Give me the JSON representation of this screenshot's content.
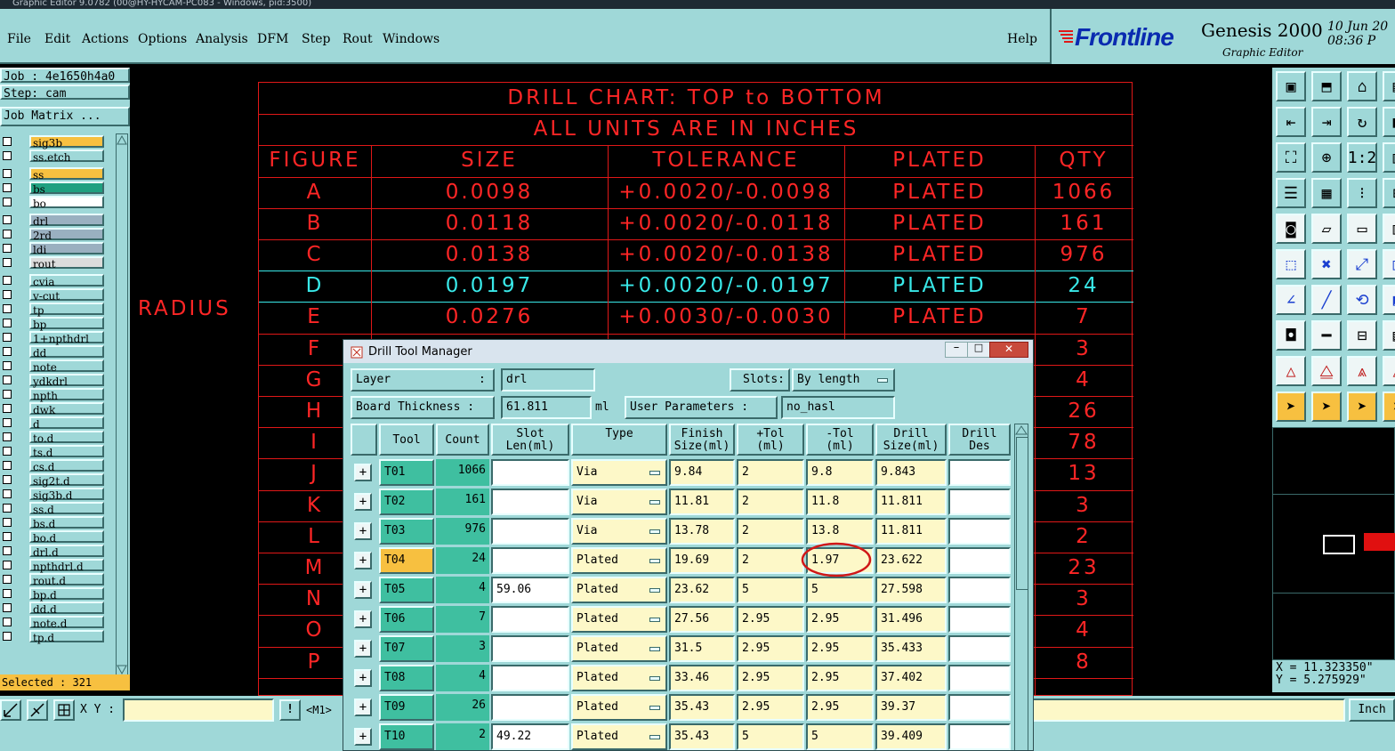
{
  "window_title": "Graphic Editor 9.0782 (00@HY-HYCAM-PC083 - Windows, pid:3500)",
  "menu": [
    "File",
    "Edit",
    "Actions",
    "Options",
    "Analysis",
    "DFM",
    "Step",
    "Rout",
    "Windows"
  ],
  "help": "Help",
  "brand": {
    "logo": "Frontline",
    "product": "Genesis 2000",
    "subtitle": "Graphic Editor",
    "date": "10 Jun 20",
    "time": "08:36 P"
  },
  "job": "Job : 4e1650h4a0",
  "step": "Step: cam",
  "job_matrix": "Job Matrix ...",
  "layers": [
    {
      "name": "sig3b",
      "color": "#f7c040"
    },
    {
      "name": "ss.etch",
      "color": "#9fd8d8"
    },
    {
      "name": "ss",
      "color": "#f7c040"
    },
    {
      "name": "bs",
      "color": "#20a080"
    },
    {
      "name": "bo",
      "color": "#ffffff"
    },
    {
      "name": "drl",
      "color": "#9ab0c0"
    },
    {
      "name": "2rd",
      "color": "#9ab0c0"
    },
    {
      "name": "ldi",
      "color": "#9ab0c0"
    },
    {
      "name": "rout",
      "color": "#dcdcdc"
    },
    {
      "name": "cvia",
      "color": "#9fd8d8"
    },
    {
      "name": "v-cut",
      "color": "#9fd8d8"
    },
    {
      "name": "tp",
      "color": "#9fd8d8"
    },
    {
      "name": "bp",
      "color": "#9fd8d8"
    },
    {
      "name": "1+npthdrl",
      "color": "#9fd8d8"
    },
    {
      "name": "dd",
      "color": "#9fd8d8"
    },
    {
      "name": "note",
      "color": "#9fd8d8"
    },
    {
      "name": "ydkdrl",
      "color": "#9fd8d8"
    },
    {
      "name": "npth",
      "color": "#9fd8d8"
    },
    {
      "name": "dwk",
      "color": "#9fd8d8"
    },
    {
      "name": "d",
      "color": "#9fd8d8"
    },
    {
      "name": "to.d",
      "color": "#9fd8d8"
    },
    {
      "name": "ts.d",
      "color": "#9fd8d8"
    },
    {
      "name": "cs.d",
      "color": "#9fd8d8"
    },
    {
      "name": "sig2t.d",
      "color": "#9fd8d8"
    },
    {
      "name": "sig3b.d",
      "color": "#9fd8d8"
    },
    {
      "name": "ss.d",
      "color": "#9fd8d8"
    },
    {
      "name": "bs.d",
      "color": "#9fd8d8"
    },
    {
      "name": "bo.d",
      "color": "#9fd8d8"
    },
    {
      "name": "drl.d",
      "color": "#9fd8d8"
    },
    {
      "name": "npthdrl.d",
      "color": "#9fd8d8"
    },
    {
      "name": "rout.d",
      "color": "#9fd8d8"
    },
    {
      "name": "bp.d",
      "color": "#9fd8d8"
    },
    {
      "name": "dd.d",
      "color": "#9fd8d8"
    },
    {
      "name": "note.d",
      "color": "#9fd8d8"
    },
    {
      "name": "tp.d",
      "color": "#9fd8d8"
    }
  ],
  "selected": "Selected : 321",
  "chart": {
    "title1": "DRILL CHART: TOP to BOTTOM",
    "title2": "ALL UNITS ARE IN INCHES",
    "headers": [
      "FIGURE",
      "SIZE",
      "TOLERANCE",
      "PLATED",
      "QTY"
    ],
    "rows": [
      {
        "fig": "A",
        "size": "0.0098",
        "tol": "+0.0020/-0.0098",
        "plated": "PLATED",
        "qty": "1066",
        "hl": false
      },
      {
        "fig": "B",
        "size": "0.0118",
        "tol": "+0.0020/-0.0118",
        "plated": "PLATED",
        "qty": "161",
        "hl": false
      },
      {
        "fig": "C",
        "size": "0.0138",
        "tol": "+0.0020/-0.0138",
        "plated": "PLATED",
        "qty": "976",
        "hl": false
      },
      {
        "fig": "D",
        "size": "0.0197",
        "tol": "+0.0020/-0.0197",
        "plated": "PLATED",
        "qty": "24",
        "hl": true
      },
      {
        "fig": "E",
        "size": "0.0276",
        "tol": "+0.0030/-0.0030",
        "plated": "PLATED",
        "qty": "7",
        "hl": false
      },
      {
        "fig": "F",
        "size": "",
        "tol": "",
        "plated": "",
        "qty": "3",
        "hl": false
      },
      {
        "fig": "G",
        "size": "",
        "tol": "",
        "plated": "",
        "qty": "4",
        "hl": false
      },
      {
        "fig": "H",
        "size": "",
        "tol": "",
        "plated": "",
        "qty": "26",
        "hl": false
      },
      {
        "fig": "I",
        "size": "",
        "tol": "",
        "plated": "",
        "qty": "78",
        "hl": false
      },
      {
        "fig": "J",
        "size": "",
        "tol": "",
        "plated": "",
        "qty": "13",
        "hl": false
      },
      {
        "fig": "K",
        "size": "",
        "tol": "",
        "plated": "",
        "qty": "3",
        "hl": false
      },
      {
        "fig": "L",
        "size": "",
        "tol": "",
        "plated": "",
        "qty": "2",
        "hl": false
      },
      {
        "fig": "M",
        "size": "",
        "tol": "",
        "plated": "",
        "qty": "23",
        "hl": false
      },
      {
        "fig": "N",
        "size": "",
        "tol": "",
        "plated": "",
        "qty": "3",
        "hl": false
      },
      {
        "fig": "O",
        "size": "",
        "tol": "",
        "plated": "",
        "qty": "4",
        "hl": false
      },
      {
        "fig": "P",
        "size": "",
        "tol": "",
        "plated": "",
        "qty": "8",
        "hl": false
      }
    ]
  },
  "radius_label": "RADIUS",
  "coords": {
    "x": "X = 11.323350\"",
    "y": "Y = 5.275929\""
  },
  "bottom": {
    "xy_label": "X Y :",
    "mode": "<M1>",
    "unit": "Inch"
  },
  "dialog": {
    "title": "Drill Tool Manager",
    "layer_label": "Layer",
    "layer_colon": ":",
    "layer_value": "drl",
    "slots_label": "Slots:",
    "slots_value": "By length",
    "board_thickness_label": "Board Thickness :",
    "board_thickness_value": "61.811",
    "board_thickness_unit": "ml",
    "user_params_label": "User Parameters :",
    "user_params_value": "no_hasl",
    "columns": [
      "Tool",
      "Count",
      "Slot\nLen(ml)",
      "Type",
      "Finish\nSize(ml)",
      "+Tol\n(ml)",
      "-Tol\n(ml)",
      "Drill\nSize(ml)",
      "Drill\nDes"
    ],
    "tools": [
      {
        "tool": "T01",
        "count": "1066",
        "slot": "",
        "type": "Via",
        "finish": "9.84",
        "ptol": "2",
        "mtol": "9.8",
        "drill": "9.843",
        "sel": false
      },
      {
        "tool": "T02",
        "count": "161",
        "slot": "",
        "type": "Via",
        "finish": "11.81",
        "ptol": "2",
        "mtol": "11.8",
        "drill": "11.811",
        "sel": false
      },
      {
        "tool": "T03",
        "count": "976",
        "slot": "",
        "type": "Via",
        "finish": "13.78",
        "ptol": "2",
        "mtol": "13.8",
        "drill": "11.811",
        "sel": false
      },
      {
        "tool": "T04",
        "count": "24",
        "slot": "",
        "type": "Plated",
        "finish": "19.69",
        "ptol": "2",
        "mtol": "1.97",
        "drill": "23.622",
        "sel": true
      },
      {
        "tool": "T05",
        "count": "4",
        "slot": "59.06",
        "type": "Plated",
        "finish": "23.62",
        "ptol": "5",
        "mtol": "5",
        "drill": "27.598",
        "sel": false
      },
      {
        "tool": "T06",
        "count": "7",
        "slot": "",
        "type": "Plated",
        "finish": "27.56",
        "ptol": "2.95",
        "mtol": "2.95",
        "drill": "31.496",
        "sel": false
      },
      {
        "tool": "T07",
        "count": "3",
        "slot": "",
        "type": "Plated",
        "finish": "31.5",
        "ptol": "2.95",
        "mtol": "2.95",
        "drill": "35.433",
        "sel": false
      },
      {
        "tool": "T08",
        "count": "4",
        "slot": "",
        "type": "Plated",
        "finish": "33.46",
        "ptol": "2.95",
        "mtol": "2.95",
        "drill": "37.402",
        "sel": false
      },
      {
        "tool": "T09",
        "count": "26",
        "slot": "",
        "type": "Plated",
        "finish": "35.43",
        "ptol": "2.95",
        "mtol": "2.95",
        "drill": "39.37",
        "sel": false
      },
      {
        "tool": "T10",
        "count": "2",
        "slot": "49.22",
        "type": "Plated",
        "finish": "35.43",
        "ptol": "5",
        "mtol": "5",
        "drill": "39.409",
        "sel": false
      }
    ]
  },
  "colors": {
    "panel": "#9fd8d8",
    "chart_red": "#ff2626",
    "chart_cyan": "#39e8e8",
    "cell_yellow": "#fdf8c8",
    "tool_green": "#3fbfa0",
    "selected_orange": "#f7c040"
  }
}
